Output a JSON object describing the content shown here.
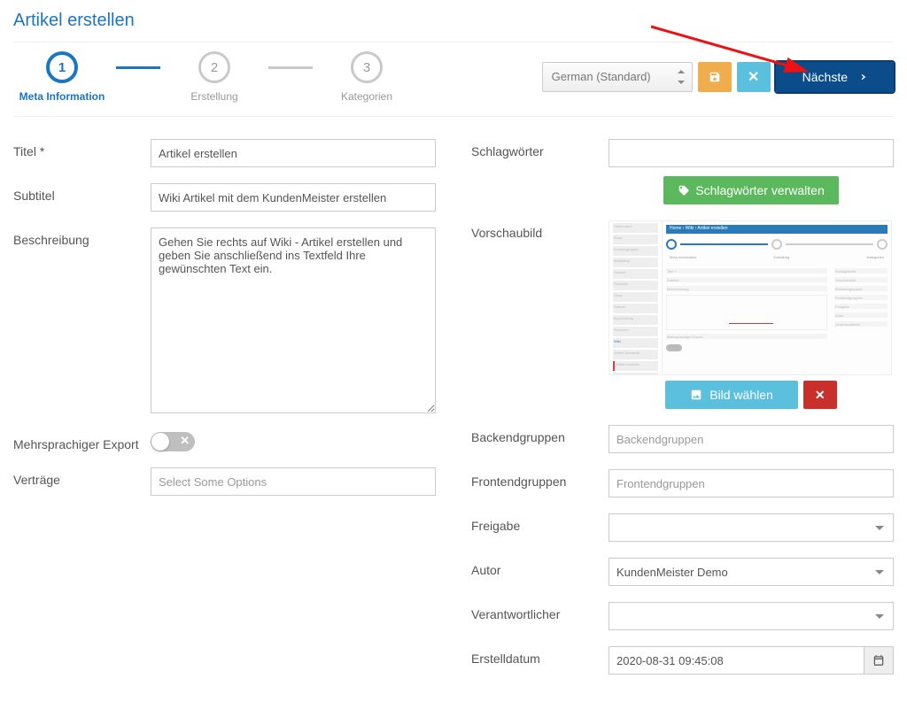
{
  "pageTitle": "Artikel erstellen",
  "wizard": {
    "step1": {
      "num": "1",
      "label": "Meta Information"
    },
    "step2": {
      "num": "2",
      "label": "Erstellung"
    },
    "step3": {
      "num": "3",
      "label": "Kategorien"
    }
  },
  "toolbar": {
    "language": "German (Standard)",
    "next": "Nächste"
  },
  "left": {
    "title_label": "Titel *",
    "title_value": "Artikel erstellen",
    "subtitle_label": "Subtitel",
    "subtitle_value": "Wiki Artikel mit dem KundenMeister erstellen",
    "desc_label": "Beschreibung",
    "desc_value": "Gehen Sie rechts auf Wiki - Artikel erstellen und geben Sie anschließend ins Textfeld Ihre gewünschten Text ein.",
    "multilang_label": "Mehrsprachiger Export",
    "contracts_label": "Verträge",
    "contracts_placeholder": "Select Some Options"
  },
  "right": {
    "tags_label": "Schlagwörter",
    "tags_btn": "Schlagwörter verwalten",
    "preview_label": "Vorschaubild",
    "img_btn": "Bild wählen",
    "backend_label": "Backendgruppen",
    "backend_ph": "Backendgruppen",
    "frontend_label": "Frontendgruppen",
    "frontend_ph": "Frontendgruppen",
    "release_label": "Freigabe",
    "author_label": "Autor",
    "author_value": "KundenMeister Demo",
    "resp_label": "Verantwortlicher",
    "date_label": "Erstelldatum",
    "date_value": "2020-08-31 09:45:08"
  }
}
